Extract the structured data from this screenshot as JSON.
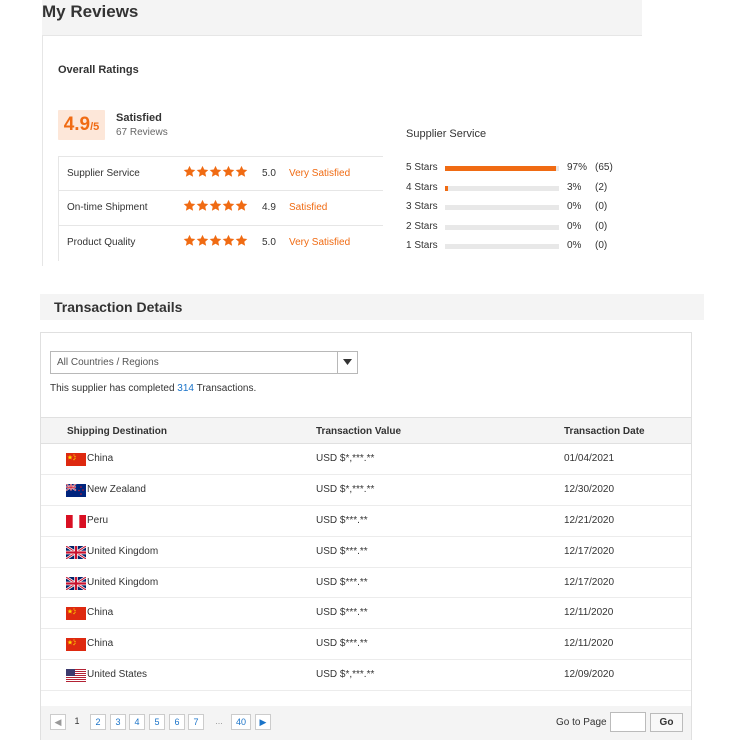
{
  "reviews": {
    "title": "My Reviews",
    "overall_title": "Overall Ratings",
    "score": "4.9",
    "score_max": "/5",
    "satisfaction": "Satisfied",
    "review_count": "67 Reviews",
    "ratings": [
      {
        "name": "Supplier Service",
        "stars": 5,
        "value": "5.0",
        "label": "Very Satisfied"
      },
      {
        "name": "On-time Shipment",
        "stars": 5,
        "value": "4.9",
        "label": "Satisfied"
      },
      {
        "name": "Product Quality",
        "stars": 5,
        "value": "5.0",
        "label": "Very Satisfied"
      }
    ],
    "distribution_title": "Supplier Service",
    "distribution": [
      {
        "label": "5 Stars",
        "fraction": 0.97,
        "pct": "97%",
        "count": "(65)"
      },
      {
        "label": "4 Stars",
        "fraction": 0.03,
        "pct": "3%",
        "count": "(2)"
      },
      {
        "label": "3 Stars",
        "fraction": 0,
        "pct": "0%",
        "count": "(0)"
      },
      {
        "label": "2 Stars",
        "fraction": 0,
        "pct": "0%",
        "count": "(0)"
      },
      {
        "label": "1 Stars",
        "fraction": 0,
        "pct": "0%",
        "count": "(0)"
      }
    ],
    "accent_color": "#f06b13"
  },
  "transactions": {
    "title": "Transaction Details",
    "region_select": "All Countries / Regions",
    "completed_prefix": "This supplier has completed ",
    "completed_count": "314",
    "completed_suffix": " Transactions.",
    "columns": [
      "Shipping Destination",
      "Transaction Value",
      "Transaction Date"
    ],
    "rows": [
      {
        "flag": "china-flag",
        "country": "China",
        "value": "USD $*,***.**",
        "date": "01/04/2021"
      },
      {
        "flag": "new-zealand-flag",
        "country": "New Zealand",
        "value": "USD $*,***.**",
        "date": "12/30/2020"
      },
      {
        "flag": "peru-flag",
        "country": "Peru",
        "value": "USD $***.**",
        "date": "12/21/2020"
      },
      {
        "flag": "uk-flag",
        "country": "United Kingdom",
        "value": "USD $***.**",
        "date": "12/17/2020"
      },
      {
        "flag": "uk-flag",
        "country": "United Kingdom",
        "value": "USD $***.**",
        "date": "12/17/2020"
      },
      {
        "flag": "china-flag",
        "country": "China",
        "value": "USD $***.**",
        "date": "12/11/2020"
      },
      {
        "flag": "china-flag",
        "country": "China",
        "value": "USD $***.**",
        "date": "12/11/2020"
      },
      {
        "flag": "us-flag",
        "country": "United States",
        "value": "USD $*,***.**",
        "date": "12/09/2020"
      }
    ],
    "pagination": {
      "pages": [
        "1",
        "2",
        "3",
        "4",
        "5",
        "6",
        "7",
        "...",
        "40"
      ],
      "current": "1",
      "goto_label": "Go to Page",
      "go_button": "Go"
    }
  }
}
